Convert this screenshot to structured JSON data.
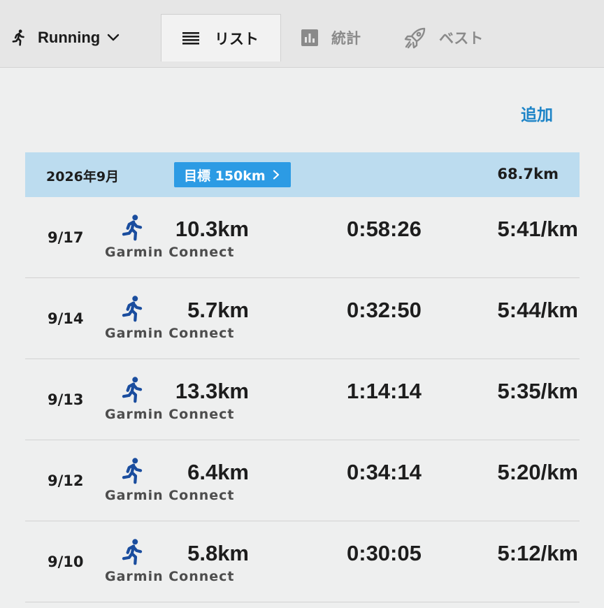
{
  "header": {
    "sport": "Running",
    "sport_icon": "running-person-icon",
    "tabs": {
      "list": "リスト",
      "stats": "統計",
      "best": "ベスト"
    }
  },
  "actions": {
    "add": "追加"
  },
  "colors": {
    "accent": "#1d84c7",
    "goal_button": "#2c9be4",
    "month_bar": "#bcdcef",
    "activity_icon": "#1a4d9e"
  },
  "month": {
    "label": "2026年9月",
    "goal": "目標 150km",
    "total": "68.7km"
  },
  "activities": [
    {
      "date": "9/17",
      "source": "Garmin Connect",
      "distance": "10.3km",
      "duration": "0:58:26",
      "pace": "5:41/km"
    },
    {
      "date": "9/14",
      "source": "Garmin Connect",
      "distance": "5.7km",
      "duration": "0:32:50",
      "pace": "5:44/km"
    },
    {
      "date": "9/13",
      "source": "Garmin Connect",
      "distance": "13.3km",
      "duration": "1:14:14",
      "pace": "5:35/km"
    },
    {
      "date": "9/12",
      "source": "Garmin Connect",
      "distance": "6.4km",
      "duration": "0:34:14",
      "pace": "5:20/km"
    },
    {
      "date": "9/10",
      "source": "Garmin Connect",
      "distance": "5.8km",
      "duration": "0:30:05",
      "pace": "5:12/km"
    }
  ]
}
